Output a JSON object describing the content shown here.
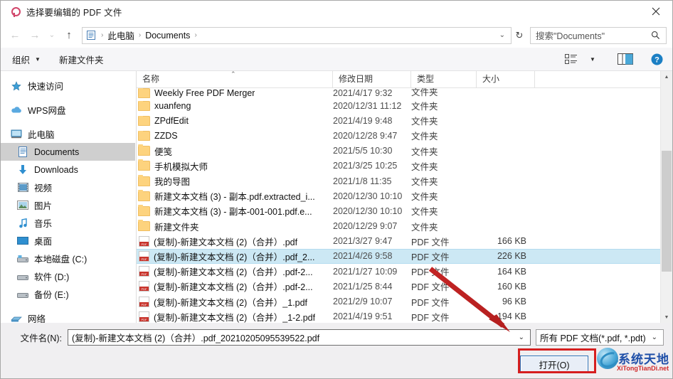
{
  "window": {
    "title": "选择要编辑的 PDF 文件",
    "icon": "app-icon",
    "close_label": "✕"
  },
  "nav": {
    "back": "←",
    "forward": "→",
    "history": "⌄",
    "up": "↑",
    "refresh": "↻",
    "dropdown": "⌄",
    "breadcrumbs": [
      "此电脑",
      "Documents"
    ],
    "separator": "›"
  },
  "search": {
    "placeholder": "搜索\"Documents\"",
    "icon": "search-icon"
  },
  "toolbar": {
    "organize_label": "组织",
    "new_folder_label": "新建文件夹",
    "caret": "▼",
    "view_icon": "view-options-icon",
    "view_caret": "▼",
    "preview_icon": "preview-pane-icon",
    "help_icon": "help-icon"
  },
  "sidebar": {
    "items": [
      {
        "label": "快速访问",
        "icon": "star-icon",
        "indent": 0,
        "selected": false
      },
      {
        "label": "WPS网盘",
        "icon": "cloud-icon",
        "indent": 0,
        "selected": false
      },
      {
        "label": "此电脑",
        "icon": "computer-icon",
        "indent": 0,
        "selected": false
      },
      {
        "label": "Documents",
        "icon": "documents-icon",
        "indent": 1,
        "selected": true
      },
      {
        "label": "Downloads",
        "icon": "download-icon",
        "indent": 1,
        "selected": false
      },
      {
        "label": "视频",
        "icon": "video-icon",
        "indent": 1,
        "selected": false
      },
      {
        "label": "图片",
        "icon": "pictures-icon",
        "indent": 1,
        "selected": false
      },
      {
        "label": "音乐",
        "icon": "music-icon",
        "indent": 1,
        "selected": false
      },
      {
        "label": "桌面",
        "icon": "desktop-icon",
        "indent": 1,
        "selected": false
      },
      {
        "label": "本地磁盘 (C:)",
        "icon": "drive-icon",
        "indent": 1,
        "selected": false
      },
      {
        "label": "软件 (D:)",
        "icon": "drive-icon",
        "indent": 1,
        "selected": false
      },
      {
        "label": "备份 (E:)",
        "icon": "drive-icon",
        "indent": 1,
        "selected": false
      },
      {
        "label": "网络",
        "icon": "network-icon",
        "indent": 0,
        "selected": false
      }
    ]
  },
  "filelist": {
    "columns": [
      "名称",
      "修改日期",
      "类型",
      "大小"
    ],
    "sort_indicator": "⌃",
    "rows": [
      {
        "name": "Weekly Free PDF Merger",
        "date": "2021/4/17 9:32",
        "type": "文件夹",
        "size": "",
        "icon": "folder-icon",
        "selected": false,
        "clipped": true
      },
      {
        "name": "xuanfeng",
        "date": "2020/12/31 11:12",
        "type": "文件夹",
        "size": "",
        "icon": "folder-icon",
        "selected": false
      },
      {
        "name": "ZPdfEdit",
        "date": "2021/4/19 9:48",
        "type": "文件夹",
        "size": "",
        "icon": "folder-icon",
        "selected": false
      },
      {
        "name": "ZZDS",
        "date": "2020/12/28 9:47",
        "type": "文件夹",
        "size": "",
        "icon": "folder-icon",
        "selected": false
      },
      {
        "name": "便笺",
        "date": "2021/5/5 10:30",
        "type": "文件夹",
        "size": "",
        "icon": "folder-icon",
        "selected": false
      },
      {
        "name": "手机模拟大师",
        "date": "2021/3/25 10:25",
        "type": "文件夹",
        "size": "",
        "icon": "folder-icon",
        "selected": false
      },
      {
        "name": "我的导图",
        "date": "2021/1/8 11:35",
        "type": "文件夹",
        "size": "",
        "icon": "folder-icon",
        "selected": false
      },
      {
        "name": "新建文本文档 (3) - 副本.pdf.extracted_i...",
        "date": "2020/12/30 10:10",
        "type": "文件夹",
        "size": "",
        "icon": "folder-icon",
        "selected": false
      },
      {
        "name": "新建文本文档 (3) - 副本-001-001.pdf.e...",
        "date": "2020/12/30 10:10",
        "type": "文件夹",
        "size": "",
        "icon": "folder-icon",
        "selected": false
      },
      {
        "name": "新建文件夹",
        "date": "2020/12/29 9:07",
        "type": "文件夹",
        "size": "",
        "icon": "folder-icon",
        "selected": false
      },
      {
        "name": "(复制)-新建文本文档 (2)（合并）.pdf",
        "date": "2021/3/27 9:47",
        "type": "PDF 文件",
        "size": "166 KB",
        "icon": "pdf-icon",
        "selected": false
      },
      {
        "name": "(复制)-新建文本文档 (2)（合并）.pdf_2...",
        "date": "2021/4/26 9:58",
        "type": "PDF 文件",
        "size": "226 KB",
        "icon": "pdf-icon",
        "selected": true
      },
      {
        "name": "(复制)-新建文本文档 (2)（合并）.pdf-2...",
        "date": "2021/1/27 10:09",
        "type": "PDF 文件",
        "size": "164 KB",
        "icon": "pdf-icon",
        "selected": false
      },
      {
        "name": "(复制)-新建文本文档 (2)（合并）.pdf-2...",
        "date": "2021/1/25 8:44",
        "type": "PDF 文件",
        "size": "160 KB",
        "icon": "pdf-icon",
        "selected": false
      },
      {
        "name": "(复制)-新建文本文档 (2)（合并）_1.pdf",
        "date": "2021/2/9 10:07",
        "type": "PDF 文件",
        "size": "96 KB",
        "icon": "pdf-icon",
        "selected": false
      },
      {
        "name": "(复制)-新建文本文档 (2)（合并）_1-2.pdf",
        "date": "2021/4/19 9:51",
        "type": "PDF 文件",
        "size": "194 KB",
        "icon": "pdf-icon",
        "selected": false
      }
    ]
  },
  "footer": {
    "filename_label": "文件名(N):",
    "filename_value": "(复制)-新建文本文档 (2)（合并）.pdf_20210205095539522.pdf",
    "filename_chevron": "⌄",
    "filter_value": "所有 PDF 文档(*.pdf, *.pdt)",
    "filter_chevron": "⌄",
    "open_button": "打开(O)"
  },
  "watermark": {
    "title": "系统天地",
    "subtitle": "XiTongTianDi.net",
    "icon": "globe-icon"
  },
  "annotations": {
    "highlight_color": "#d61f1f",
    "arrow": "red-arrow-pointer"
  }
}
